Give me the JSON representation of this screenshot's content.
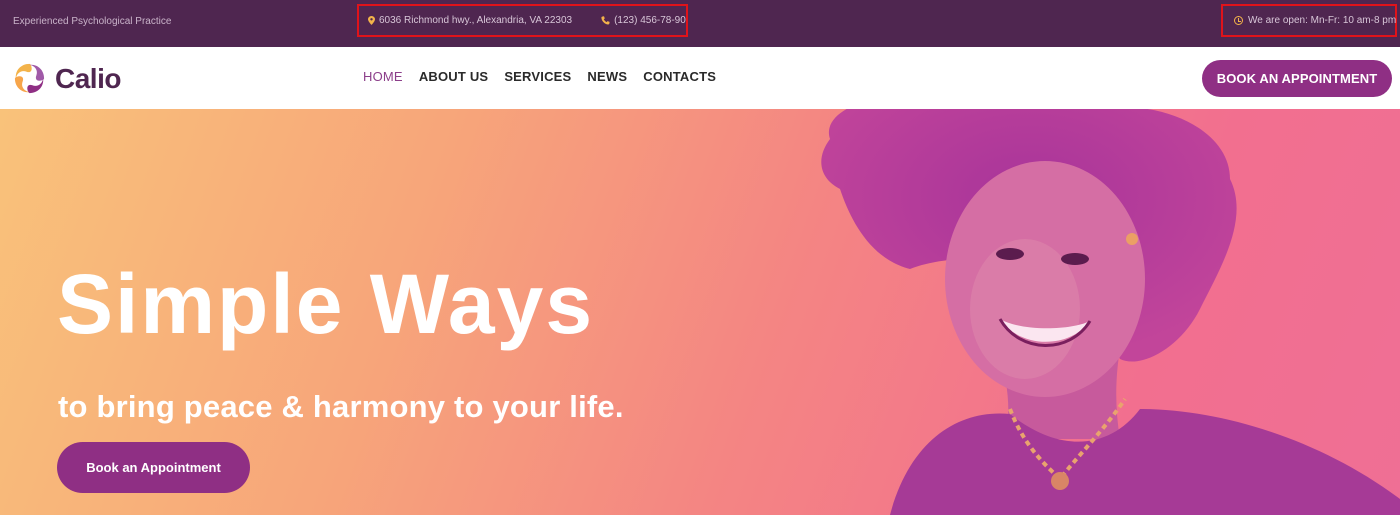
{
  "topbar": {
    "tagline": "Experienced Psychological Practice",
    "address": "6036 Richmond hwy., Alexandria, VA 22303",
    "phone": "(123) 456-78-90",
    "hours": "We are open: Mn-Fr: 10 am-8 pm",
    "icons": {
      "address": "map-pin-icon",
      "phone": "phone-icon",
      "hours": "clock-icon"
    }
  },
  "header": {
    "logo_text": "Calio",
    "nav": [
      {
        "label": "HOME",
        "active": true
      },
      {
        "label": "ABOUT US"
      },
      {
        "label": "SERVICES"
      },
      {
        "label": "NEWS"
      },
      {
        "label": "CONTACTS"
      }
    ],
    "cta_label": "BOOK AN APPOINTMENT"
  },
  "hero": {
    "title": "Simple Ways",
    "subtitle": "to bring peace & harmony to your life.",
    "cta_label": "Book an Appointment"
  },
  "colors": {
    "topbar_bg": "#4f2650",
    "brand_purple": "#8f2f84",
    "accent_gold": "#f3b34a",
    "highlight_border": "#e0131a"
  }
}
